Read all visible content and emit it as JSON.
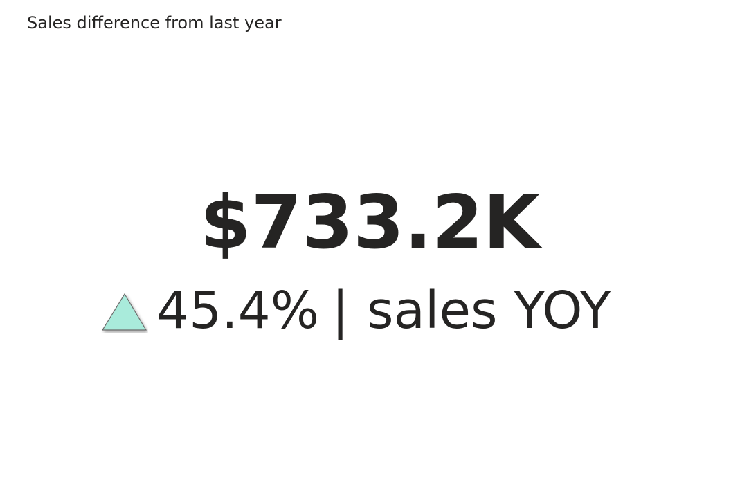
{
  "card": {
    "title": "Sales difference from last year",
    "value": "$733.2K",
    "trend": {
      "direction": "up",
      "icon": "triangle-up-icon",
      "color": "#A9EBDB",
      "percent": "45.4%",
      "separator": "|",
      "label": "sales YOY"
    }
  }
}
